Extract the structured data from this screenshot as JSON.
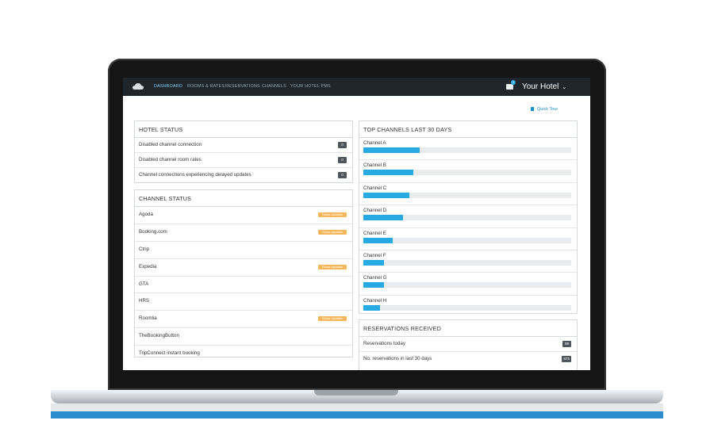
{
  "nav": {
    "items": [
      "DASHBOARD",
      "ROOMS & RATES",
      "RESERVATIONS",
      "CHANNELS",
      "YOUR HOTEL PMS"
    ],
    "notification_count": "2",
    "hotel_name": "Your Hotel"
  },
  "quick_tour": "Quick Tour",
  "hotel_status": {
    "title": "HOTEL STATUS",
    "rows": [
      {
        "label": "Disabled channel connection",
        "count": "0"
      },
      {
        "label": "Disabled channel room rates",
        "count": "0"
      },
      {
        "label": "Channel connections experiencing delayed updates",
        "count": "0"
      }
    ]
  },
  "channel_status": {
    "title": "CHANNEL STATUS",
    "badge_label": "Show Updates",
    "rows": [
      {
        "label": "Agoda"
      },
      {
        "label": "Booking.com"
      },
      {
        "label": "Ctrip"
      },
      {
        "label": "Expedia"
      },
      {
        "label": "GTA"
      },
      {
        "label": "HRS"
      },
      {
        "label": "Roomlia"
      },
      {
        "label": "TheBookingButton"
      },
      {
        "label": "TripConnect instant booking"
      }
    ],
    "rows_with_updates": [
      "Agoda",
      "Booking.com",
      "Expedia",
      "Roomlia"
    ]
  },
  "top_channels": {
    "title": "TOP CHANNELS LAST 30 DAYS",
    "channels": [
      {
        "label": "Channel A",
        "share": 0.27
      },
      {
        "label": "Channel B",
        "share": 0.24
      },
      {
        "label": "Channel C",
        "share": 0.22
      },
      {
        "label": "Channel D",
        "share": 0.19
      },
      {
        "label": "Channel E",
        "share": 0.14
      },
      {
        "label": "Channel F",
        "share": 0.1
      },
      {
        "label": "Channel G",
        "share": 0.1
      },
      {
        "label": "Channel H",
        "share": 0.08
      }
    ]
  },
  "reservations": {
    "title": "RESERVATIONS RECEIVED",
    "rows": [
      {
        "label": "Reservations today",
        "count": "98"
      },
      {
        "label": "No. reservations in last 30 days",
        "count": "875"
      }
    ]
  },
  "colors": {
    "navbar": "#1f262b",
    "accent": "#27a9e2",
    "badge": "#f4b75c"
  }
}
